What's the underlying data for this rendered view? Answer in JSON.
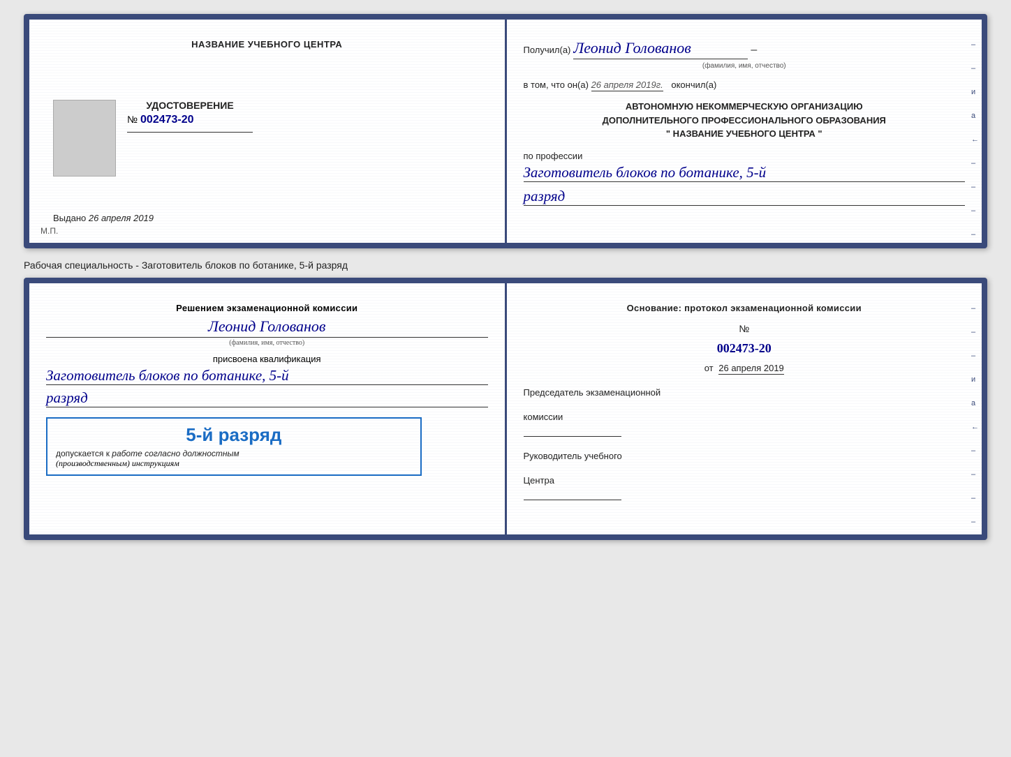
{
  "top_doc": {
    "left": {
      "institution_name": "НАЗВАНИЕ УЧЕБНОГО ЦЕНТРА",
      "udostoverenie_label": "УДОСТОВЕРЕНИЕ",
      "number_prefix": "№",
      "number": "002473-20",
      "vydano_label": "Выдано",
      "vydano_date": "26 апреля 2019",
      "mp_label": "М.П."
    },
    "right": {
      "poluchil_prefix": "Получил(а)",
      "recipient_name": "Леонид Голованов",
      "fio_hint": "(фамилия, имя, отчество)",
      "vtom_text": "в том, что он(а)",
      "completion_date": "26 апреля 2019г.",
      "okonchil": "окончил(а)",
      "avtonomnuyu_line1": "АВТОНОМНУЮ НЕКОММЕРЧЕСКУЮ ОРГАНИЗАЦИЮ",
      "avtonomnuyu_line2": "ДОПОЛНИТЕЛЬНОГО ПРОФЕССИОНАЛЬНОГО ОБРАЗОВАНИЯ",
      "institution_quote": "\" НАЗВАНИЕ УЧЕБНОГО ЦЕНТРА \"",
      "po_professii_label": "по профессии",
      "profession_name": "Заготовитель блоков по ботанике, 5-й",
      "razryad_text": "разряд",
      "dash": "–"
    }
  },
  "specialty_label": "Рабочая специальность - Заготовитель блоков по ботанике, 5-й разряд",
  "bottom_doc": {
    "left": {
      "resheniem_text": "Решением экзаменационной комиссии",
      "recipient_name": "Леонид Голованов",
      "fio_hint": "(фамилия, имя, отчество)",
      "prisvoena_text": "присвоена квалификация",
      "profession_name": "Заготовитель блоков по ботанике, 5-й",
      "razryad_text": "разряд",
      "stamp_grade": "5-й разряд",
      "dopuskaetsya_prefix": "допускается к",
      "dopuskaetsya_text": "работе согласно должностным",
      "instruktsiyam_text": "(производственным) инструкциям"
    },
    "right": {
      "osnovanie_text": "Основание: протокол экзаменационной комиссии",
      "number_prefix": "№",
      "protocol_number": "002473-20",
      "ot_prefix": "от",
      "ot_date": "26 апреля 2019",
      "predsedatel_line1": "Председатель экзаменационной",
      "predsedatel_line2": "комиссии",
      "rukovoditel_line1": "Руководитель учебного",
      "rukovoditel_line2": "Центра"
    }
  }
}
